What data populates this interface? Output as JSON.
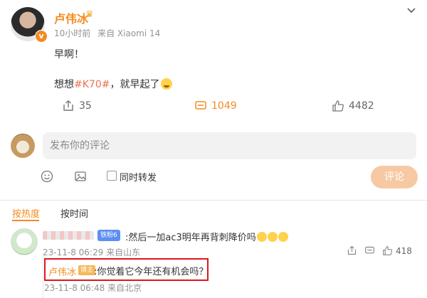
{
  "post": {
    "author": "卢伟冰",
    "time": "10小时前",
    "source": "来自 Xiaomi 14",
    "line1": "早啊！",
    "line2_prefix": "想想",
    "hashtag": "#K70#",
    "line2_suffix": "，就早起了",
    "actions": {
      "share": "35",
      "comments": "1049",
      "likes": "4482"
    }
  },
  "composer": {
    "placeholder": "发布你的评论",
    "repost_label": "同时转发",
    "submit_label": "评论"
  },
  "sort": {
    "hot": "按热度",
    "time": "按时间"
  },
  "comment": {
    "fan_badge": "铁粉6",
    "text": ":然后一加ac3明年再背刺降价吗",
    "date": "23-11-8 06:29",
    "location": "来自山东",
    "likes": "418"
  },
  "reply": {
    "author": "卢伟冰",
    "badge": "博主",
    "text": ":你觉着它今年还有机会吗？",
    "date": "23-11-8 06:48",
    "location": "来自北京"
  },
  "colors": {
    "accent": "#f28b1f",
    "highlight_border": "#e0161b",
    "muted": "#939393"
  },
  "icons": [
    "chevron-down-icon",
    "crown-icon",
    "verified-icon",
    "share-icon",
    "comment-icon",
    "like-icon",
    "emoji-icon",
    "image-icon",
    "reply-icon",
    "comment-like-icon"
  ]
}
